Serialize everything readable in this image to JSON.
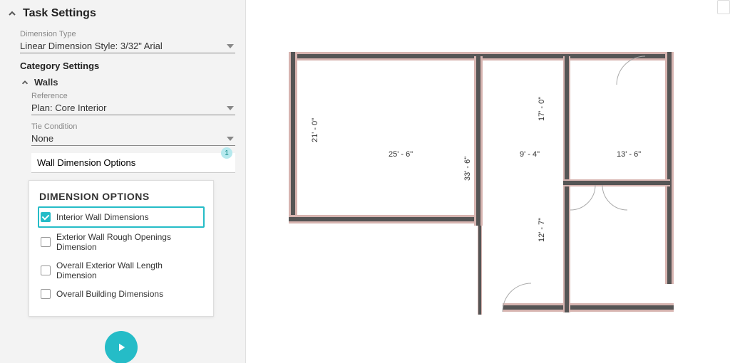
{
  "panel": {
    "title": "Task Settings",
    "dimension_type_label": "Dimension Type",
    "dimension_type_value": "Linear Dimension Style: 3/32\" Arial",
    "category_heading": "Category Settings",
    "walls_heading": "Walls",
    "reference_label": "Reference",
    "reference_value": "Plan: Core Interior",
    "tie_label": "Tie Condition",
    "tie_value": "None",
    "options_input": "Wall Dimension Options",
    "options_badge": "1",
    "dim_options_title": "DIMENSION OPTIONS",
    "options": [
      {
        "label": "Interior Wall Dimensions",
        "checked": true,
        "highlight": true
      },
      {
        "label": "Exterior Wall Rough Openings Dimension",
        "checked": false,
        "highlight": false
      },
      {
        "label": "Overall Exterior Wall Length Dimension",
        "checked": false,
        "highlight": false
      },
      {
        "label": "Overall Building Dimensions",
        "checked": false,
        "highlight": false
      }
    ]
  },
  "dimensions": {
    "v_left": "21' - 0\"",
    "h_top_left": "25' - 6\"",
    "h_top_mid": "9' - 4\"",
    "h_top_right": "13' - 6\"",
    "v_right_top": "17' - 0\"",
    "v_right_bot": "12' - 7\"",
    "v_center": "33' - 6\""
  }
}
